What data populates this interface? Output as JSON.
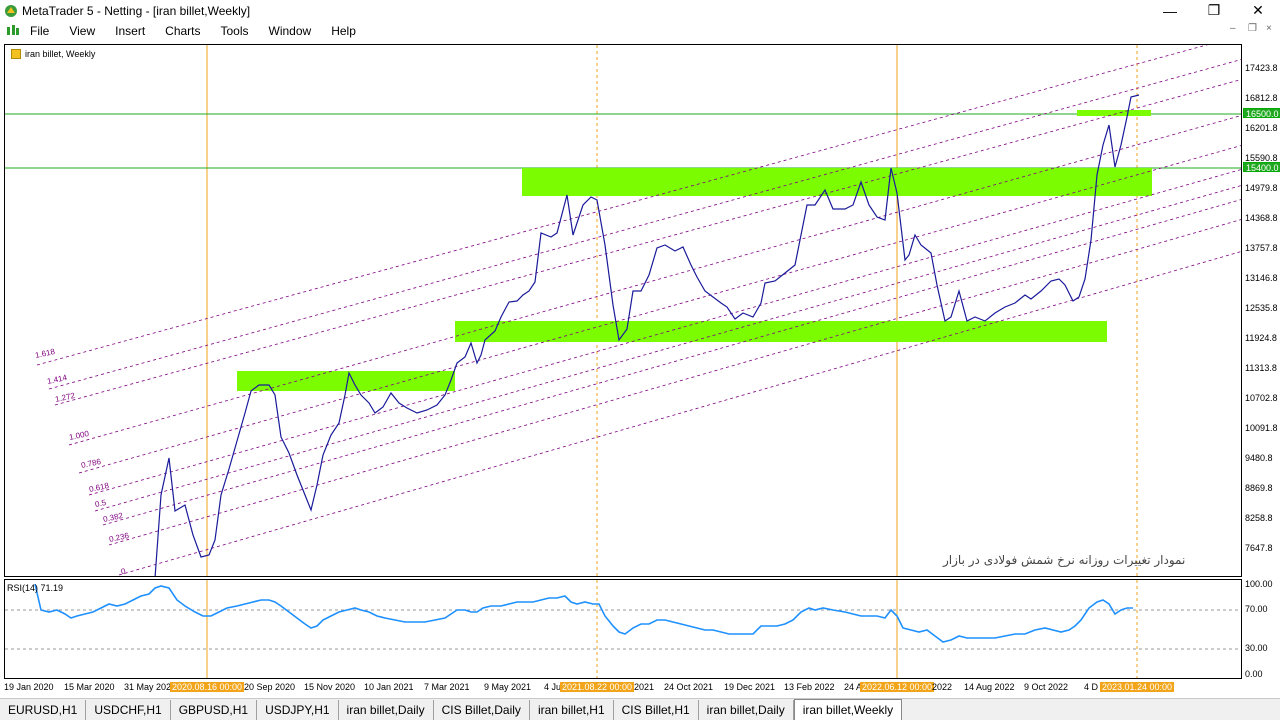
{
  "window": {
    "title": "MetaTrader 5 - Netting - [iran billet,Weekly]",
    "minimize": "—",
    "maximize": "❐",
    "close": "✕"
  },
  "menu": [
    "File",
    "View",
    "Insert",
    "Charts",
    "Tools",
    "Window",
    "Help"
  ],
  "mdi_controls": [
    "–",
    "❐",
    "×"
  ],
  "chart": {
    "label": "iran billet, Weekly",
    "annotation": "نمودار تغییرات روزانه نرخ شمش فولادی در بازار",
    "hline_labels": [
      "16500.0",
      "15400.0"
    ],
    "fib_levels": [
      "1.618",
      "1.414",
      "1.272",
      "1.000",
      "0.786",
      "0.618",
      "0.5",
      "0.382",
      "0.236",
      "0"
    ]
  },
  "price_axis": [
    "17423.8",
    "16812.8",
    "16201.8",
    "15590.8",
    "14979.8",
    "14368.8",
    "13757.8",
    "13146.8",
    "12535.8",
    "11924.8",
    "11313.8",
    "10702.8",
    "10091.8",
    "9480.8",
    "8869.8",
    "8258.8",
    "7647.8"
  ],
  "rsi": {
    "label": "RSI(14) 71.19",
    "axis": [
      "100.00",
      "70.00",
      "30.00",
      "0.00"
    ]
  },
  "time_axis": {
    "labels": [
      "19 Jan 2020",
      "15 Mar 2020",
      "31 May 202",
      "20 Sep 2020",
      "15 Nov 2020",
      "10 Jan 2021",
      "7 Mar 2021",
      "9 May 2021",
      "4 Ju",
      "2021",
      "24 Oct 2021",
      "19 Dec 2021",
      "13 Feb 2022",
      "24 A",
      "2022",
      "14 Aug 2022",
      "9 Oct 2022",
      "4 D"
    ],
    "highlighted": [
      "2020.08.16 00:00",
      "2021.08.22 00:00",
      "2022.06.12 00:00",
      "2023.01.24 00:00"
    ]
  },
  "tabs": [
    "EURUSD,H1",
    "USDCHF,H1",
    "GBPUSD,H1",
    "USDJPY,H1",
    "iran billet,Daily",
    "CIS Billet,Daily",
    "iran billet,H1",
    "CIS Billet,H1",
    "iran billet,Daily",
    "iran billet,Weekly"
  ],
  "active_tab": "iran billet,Weekly",
  "colors": {
    "price_line": "#1a1a9a",
    "rsi_line": "#1e90ff",
    "zone": "#7cfc00",
    "hline": "#1fa81f",
    "vline": "#f2a51a",
    "fib": "#800080"
  }
}
